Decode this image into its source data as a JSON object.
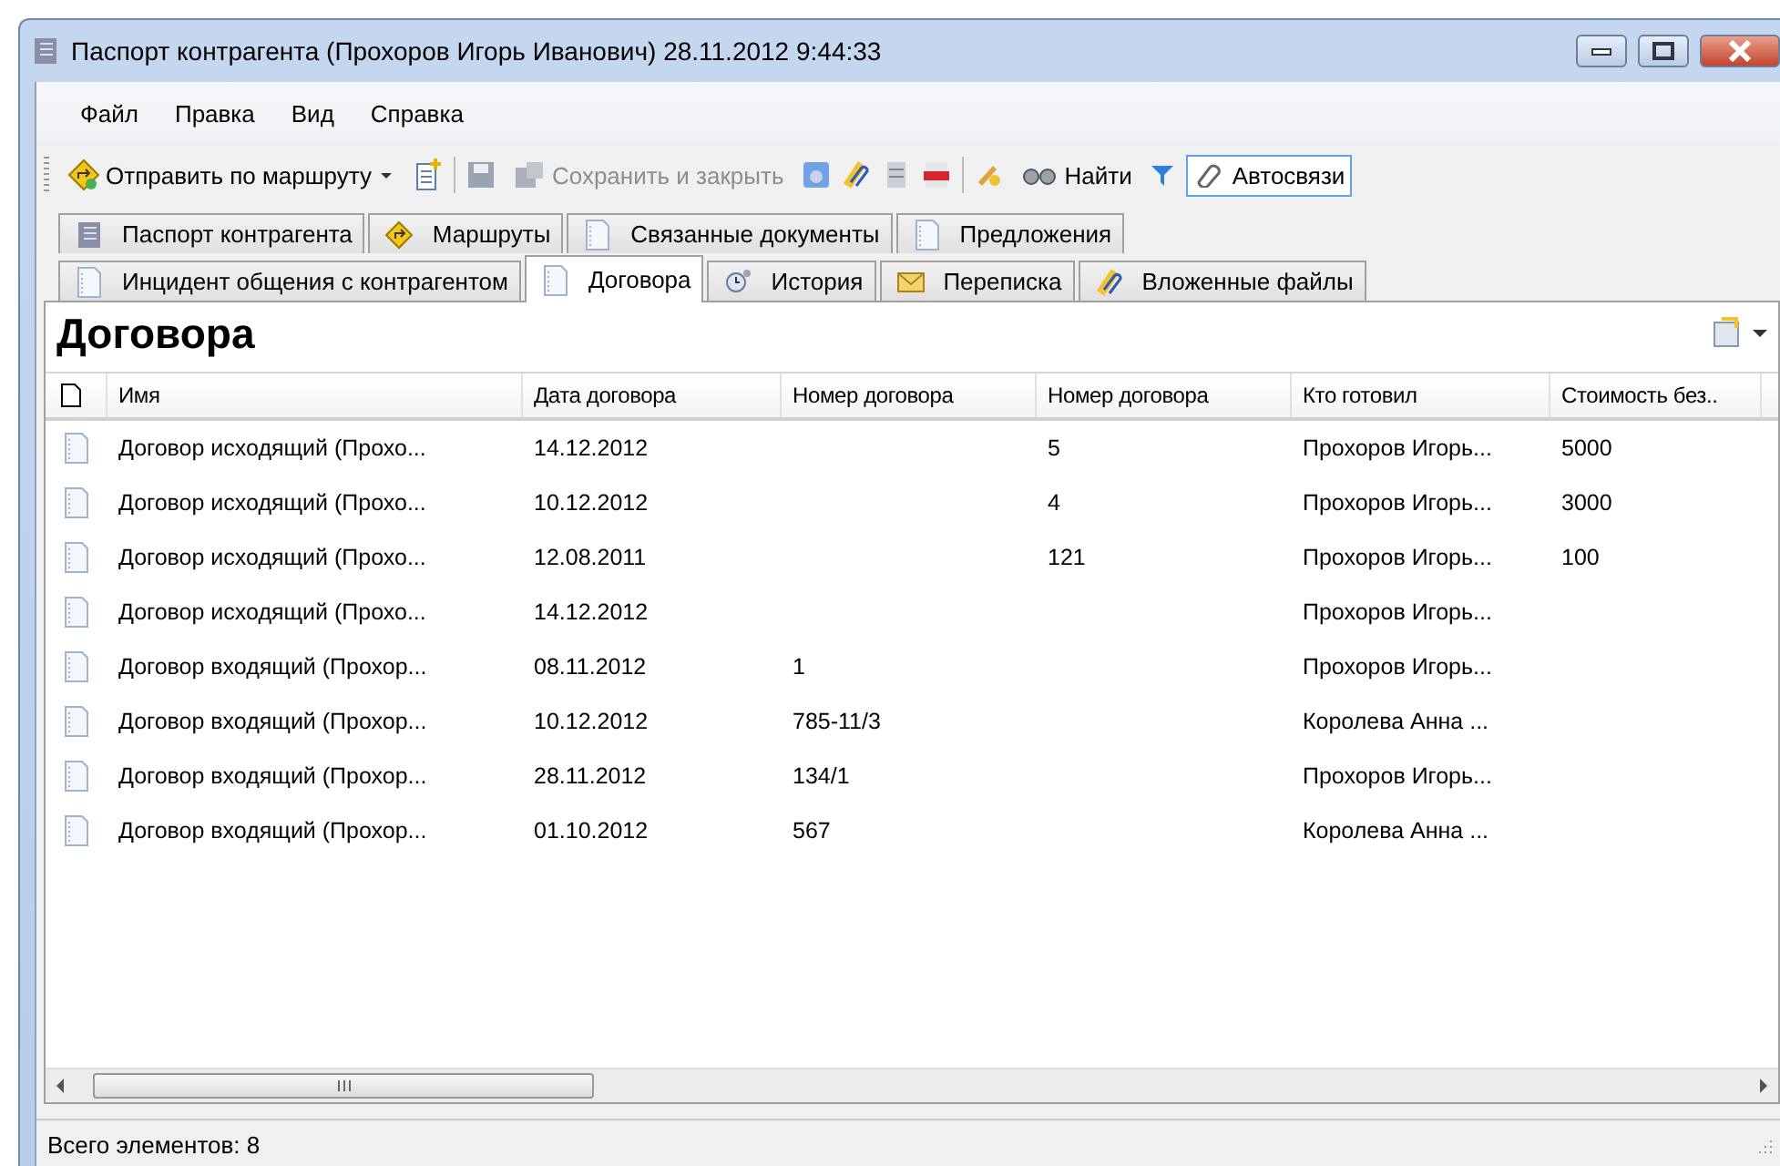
{
  "window": {
    "title": "Паспорт контрагента (Прохоров Игорь Иванович) 28.11.2012 9:44:33"
  },
  "menu": [
    "Файл",
    "Правка",
    "Вид",
    "Справка"
  ],
  "toolbar": {
    "route_button": {
      "label": "Отправить по маршруту"
    },
    "save_close_button": {
      "label": "Сохранить и закрыть",
      "disabled": true
    },
    "find_button": {
      "label": "Найти"
    },
    "autolinks_button": {
      "label": "Автосвязи",
      "checked": true
    }
  },
  "tab_rows": [
    [
      {
        "label": "Паспорт контрагента",
        "selected": false
      },
      {
        "label": "Маршруты",
        "selected": false
      },
      {
        "label": "Связанные документы",
        "selected": false
      },
      {
        "label": "Предложения",
        "selected": false
      }
    ],
    [
      {
        "label": "Инцидент общения с контрагентом",
        "selected": false
      },
      {
        "label": "Договора",
        "selected": true
      },
      {
        "label": "История",
        "selected": false
      },
      {
        "label": "Переписка",
        "selected": false
      },
      {
        "label": "Вложенные файлы",
        "selected": false
      }
    ]
  ],
  "heading": "Договора",
  "table": {
    "columns": [
      "Имя",
      "Дата договора",
      "Номер договора",
      "Номер договора",
      "Кто готовил",
      "Стоимость без.."
    ],
    "rows": [
      {
        "cells": [
          "Договор исходящий (Прохо...",
          "14.12.2012",
          "",
          "5",
          "Прохоров Игорь...",
          "5000"
        ]
      },
      {
        "cells": [
          "Договор исходящий (Прохо...",
          "10.12.2012",
          "",
          "4",
          "Прохоров Игорь...",
          "3000"
        ]
      },
      {
        "cells": [
          "Договор исходящий (Прохо...",
          "12.08.2011",
          "",
          "121",
          "Прохоров Игорь...",
          "100"
        ]
      },
      {
        "cells": [
          "Договор исходящий (Прохо...",
          "14.12.2012",
          "",
          "",
          "Прохоров Игорь...",
          ""
        ]
      },
      {
        "cells": [
          "Договор входящий (Прохор...",
          "08.11.2012",
          "1",
          "",
          "Прохоров Игорь...",
          ""
        ]
      },
      {
        "cells": [
          "Договор входящий (Прохор...",
          "10.12.2012",
          "785-11/3",
          "",
          "Королева Анна ...",
          ""
        ]
      },
      {
        "cells": [
          "Договор входящий (Прохор...",
          "28.11.2012",
          "134/1",
          "",
          "Прохоров Игорь...",
          ""
        ]
      },
      {
        "cells": [
          "Договор входящий (Прохор...",
          "01.10.2012",
          "567",
          "",
          "Королева Анна ...",
          ""
        ]
      }
    ]
  },
  "status_bar": "Всего элементов: 8"
}
